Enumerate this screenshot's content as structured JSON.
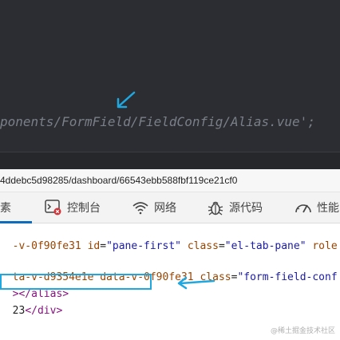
{
  "editor": {
    "code_line": "ponents/FormField/FieldConfig/Alias.vue';"
  },
  "url_bar": {
    "url": "4ddebc5d98285/dashboard/66543ebb588fbf119ce21cf0"
  },
  "devtools": {
    "tabs": [
      {
        "label": "素",
        "icon": "elements-icon",
        "active": true
      },
      {
        "label": "控制台",
        "icon": "console-icon"
      },
      {
        "label": "网络",
        "icon": "wifi-icon"
      },
      {
        "label": "源代码",
        "icon": "bug-icon"
      },
      {
        "label": "性能",
        "icon": "performance-icon"
      }
    ]
  },
  "dom": {
    "line1": {
      "pre": "-v-0f90fe31 ",
      "id_attr": "id",
      "id_val": "\"pane-first\"",
      "class_attr": "class",
      "class_val": "\"el-tab-pane\"",
      "role_attr": "role"
    },
    "line2": {
      "pre": "ta-v-d9354e1e data-v-0f90fe31 ",
      "class_attr": "class",
      "class_val": "\"form-field-conf"
    },
    "line3": {
      "text": "></alias>"
    },
    "line4": {
      "number": "23",
      "close_tag": "</div>"
    }
  },
  "colors": {
    "highlight": "#1fa7e0",
    "editor_bg": "#2b2d33"
  },
  "watermark": "@稀土掘金技术社区"
}
